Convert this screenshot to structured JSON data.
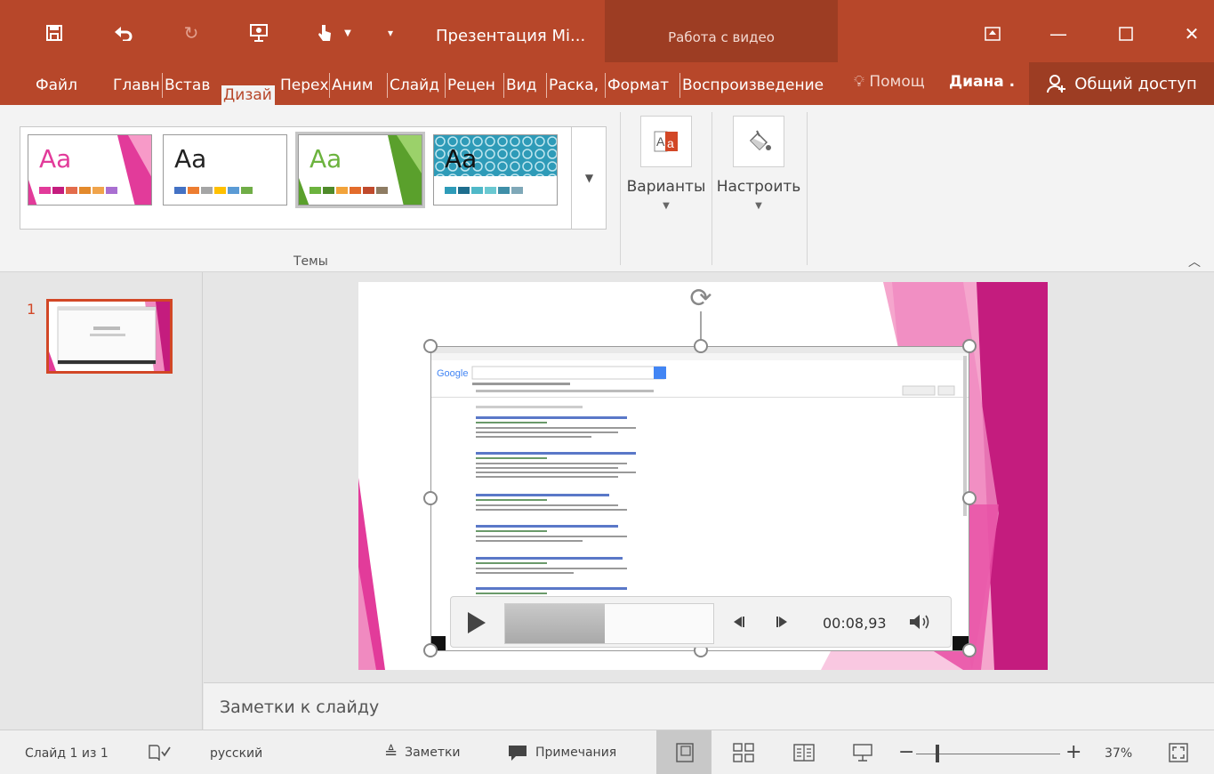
{
  "window": {
    "title": "Презентация Mi...",
    "context_tab_group": "Работа с видео"
  },
  "tabs": [
    "Файл",
    "Главн",
    "Встав",
    "Дизай",
    "Перех",
    "Аним",
    "Слайд",
    "Рецен",
    "Вид",
    "Раска,",
    "Формат",
    "Воспроизведение"
  ],
  "help": "Помощ",
  "user": "Диана .",
  "share": "Общий доступ",
  "ribbon": {
    "theme_sample": "Aa",
    "group_themes": "Темы",
    "variants": "Варианты",
    "customize": "Настроить"
  },
  "thumbs": {
    "slide_number": "1"
  },
  "player": {
    "time": "00:08,93",
    "progress": 0.48
  },
  "notes": {
    "placeholder": "Заметки к слайду"
  },
  "status": {
    "slide_info": "Слайд 1 из 1",
    "language": "русский",
    "notes": "Заметки",
    "comments": "Примечания",
    "zoom": "37%",
    "zoom_level": 0.37
  },
  "colors": {
    "accent": "#b7472a",
    "context": "#9d3d23",
    "pink": "#c41c7e"
  }
}
